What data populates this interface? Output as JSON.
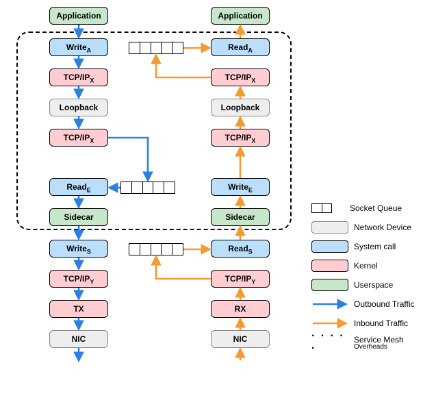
{
  "diagram": {
    "left": {
      "app": "Application",
      "write_a": "Write",
      "write_a_sub": "A",
      "tcp1": "TCP/IP",
      "tcp1_sub": "X",
      "loopback": "Loopback",
      "tcp2": "TCP/IP",
      "tcp2_sub": "X",
      "read_e": "Read",
      "read_e_sub": "E",
      "sidecar": "Sidecar",
      "write_s": "Write",
      "write_s_sub": "S",
      "tcp3": "TCP/IP",
      "tcp3_sub": "Y",
      "tx": "TX",
      "nic": "NIC"
    },
    "right": {
      "app": "Application",
      "read_a": "Read",
      "read_a_sub": "A",
      "tcp1": "TCP/IP",
      "tcp1_sub": "X",
      "loopback": "Loopback",
      "tcp2": "TCP/IP",
      "tcp2_sub": "X",
      "write_e": "Write",
      "write_e_sub": "E",
      "sidecar": "Sidecar",
      "read_s": "Read",
      "read_s_sub": "S",
      "tcp3": "TCP/IP",
      "tcp3_sub": "Y",
      "rx": "RX",
      "nic": "NIC"
    }
  },
  "legend": {
    "socket_queue": "Socket Queue",
    "network_device": "Network Device",
    "system_call": "System call",
    "kernel": "Kernel",
    "userspace": "Userspace",
    "outbound": "Outbound Traffic",
    "inbound": "Inbound Traffic",
    "overheads_l1": "Service Mesh",
    "overheads_l2": "Overheads"
  },
  "colors": {
    "userspace": "#c8e6c9",
    "system_call": "#bbdefb",
    "kernel": "#ffcdd2",
    "network_device": "#eeeeee",
    "outbound": "#2a81e2",
    "inbound": "#f79a2d"
  }
}
